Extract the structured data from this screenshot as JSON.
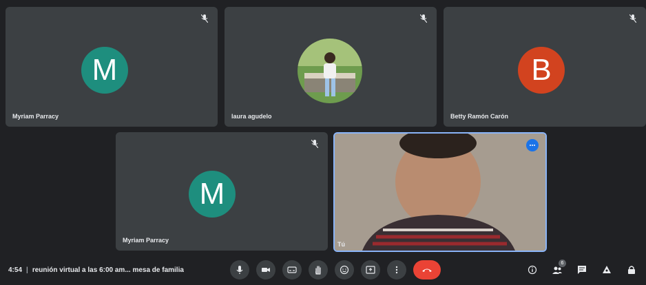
{
  "participants": [
    {
      "name": "Myriam Parracy",
      "initial": "M",
      "color": "#1e8e7e"
    },
    {
      "name": "laura agudelo",
      "initial": "",
      "color": "#7aa35a"
    },
    {
      "name": "Betty Ramón Carón",
      "initial": "B",
      "color": "#d2431f"
    },
    {
      "name": "Myriam Parracy",
      "initial": "M",
      "color": "#1e8e7e"
    }
  ],
  "self_view": {
    "label": "Tú"
  },
  "meeting": {
    "time": "4:54",
    "title": "reunión virtual a las 6:00 am... mesa de familia"
  },
  "controls": [
    "mic-icon",
    "camera-icon",
    "captions-icon",
    "raise-hand-icon",
    "emoji-icon",
    "present-icon",
    "more-options-icon",
    "end-call-icon"
  ],
  "right_controls": {
    "people_count": "6"
  },
  "colors": {
    "background": "#202124",
    "tile": "#3c4043",
    "end_call": "#ea4335",
    "accent": "#8ab4f8"
  }
}
